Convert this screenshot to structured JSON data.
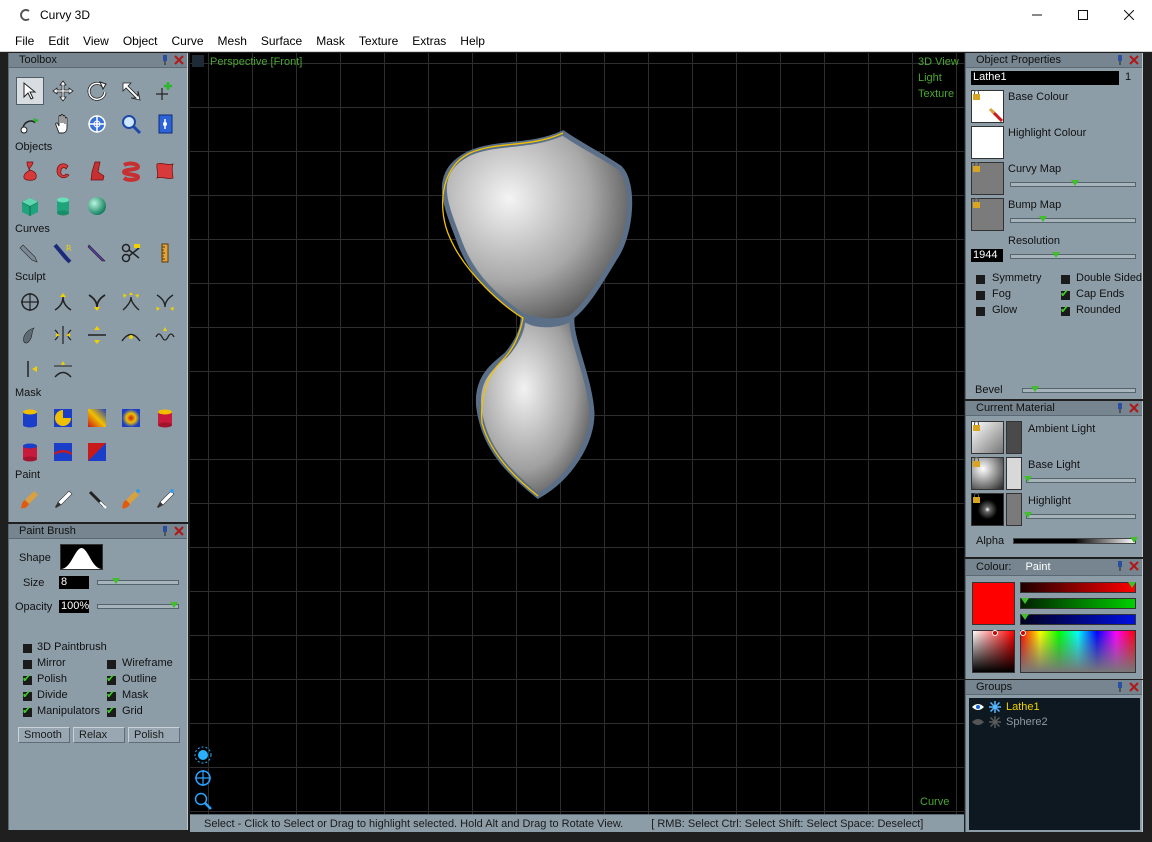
{
  "window": {
    "title": "Curvy 3D"
  },
  "menu": [
    "File",
    "Edit",
    "View",
    "Object",
    "Curve",
    "Mesh",
    "Surface",
    "Mask",
    "Texture",
    "Extras",
    "Help"
  ],
  "toolbox": {
    "title": "Toolbox",
    "sections": {
      "objects": "Objects",
      "curves": "Curves",
      "sculpt": "Sculpt",
      "mask": "Mask",
      "paint": "Paint"
    }
  },
  "paint_brush": {
    "title": "Paint Brush",
    "shape_label": "Shape",
    "size_label": "Size",
    "size_value": "8",
    "size_fraction": 0.2,
    "opacity_label": "Opacity",
    "opacity_value": "100%",
    "opacity_fraction": 1.0,
    "options": [
      {
        "label": "3D Paintbrush",
        "checked": false
      },
      {
        "label": "Mirror",
        "checked": false
      },
      {
        "label": "Wireframe",
        "checked": false
      },
      {
        "label": "Polish",
        "checked": true
      },
      {
        "label": "Outline",
        "checked": true
      },
      {
        "label": "Divide",
        "checked": true
      },
      {
        "label": "Mask",
        "checked": true
      },
      {
        "label": "Manipulators",
        "checked": true
      },
      {
        "label": "Grid",
        "checked": true
      }
    ],
    "buttons": [
      "Smooth",
      "Relax",
      "Polish"
    ]
  },
  "viewport": {
    "view_name": "Perspective [Front]",
    "modes": [
      "3D View",
      "Light",
      "Texture"
    ],
    "bottom_right": "Curve"
  },
  "status": {
    "message": "Select - Click to Select or Drag to highlight selected. Hold Alt and Drag to Rotate View.",
    "hints": "[ RMB: Select   Ctrl: Select   Shift: Select   Space: Deselect]"
  },
  "object_properties": {
    "title": "Object Properties",
    "name": "Lathe1",
    "index": "1",
    "base_colour": "Base Colour",
    "highlight_colour": "Highlight Colour",
    "curvy_map": "Curvy Map",
    "curvy_map_fraction": 0.52,
    "bump_map": "Bump Map",
    "bump_map_fraction": 0.24,
    "resolution_label": "Resolution",
    "resolution_value": "1944",
    "resolution_fraction": 0.35,
    "options": [
      {
        "label": "Symmetry",
        "checked": false
      },
      {
        "label": "Double Sided",
        "checked": false
      },
      {
        "label": "Fog",
        "checked": false
      },
      {
        "label": "Cap Ends",
        "checked": true
      },
      {
        "label": "Glow",
        "checked": false
      },
      {
        "label": "Rounded",
        "checked": true
      }
    ],
    "bevel_label": "Bevel",
    "bevel_fraction": 0.08
  },
  "current_material": {
    "title": "Current Material",
    "ambient_label": "Ambient Light",
    "base_light_label": "Base Light",
    "highlight_label": "Highlight",
    "alpha_label": "Alpha"
  },
  "colour": {
    "title": "Colour:",
    "mode": "Paint",
    "current": "#ff0000"
  },
  "groups": {
    "title": "Groups",
    "items": [
      {
        "name": "Lathe1",
        "active": true
      },
      {
        "name": "Sphere2",
        "active": false
      }
    ]
  },
  "colors": {
    "panel": "#8d9da8",
    "header": "#76858f",
    "viewport_label": "#4aa832",
    "selection": "#f2c200"
  }
}
